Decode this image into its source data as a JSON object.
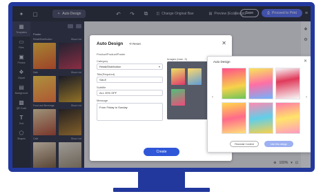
{
  "toolbar": {
    "auto_design_label": "Auto Design",
    "change_bg_label": "Change Original Bae",
    "preview_label": "Preview (Ecodesign)",
    "save_label": "Save",
    "proceed_label": "Proceed to Print"
  },
  "rail": {
    "items": [
      "Templates",
      "Files",
      "Photos",
      "Clipart",
      "Background",
      "QR Code",
      "Text",
      "Shapes"
    ]
  },
  "panel": {
    "heading": "Poster",
    "sections": [
      {
        "title": "Retail/Distribution",
        "action": "Show List"
      },
      {
        "title": "Sale",
        "action": "Show List"
      },
      {
        "title": "Food and Beverage",
        "action": "Show List"
      },
      {
        "title": "Cafe",
        "action": "Show List"
      }
    ]
  },
  "modal": {
    "title": "Auto Design",
    "reset_label": "Reset",
    "product_label": "Product/Product/Poster",
    "category_label": "Category",
    "category_value": "Retail/Distribution",
    "title_label": "Title(Required)",
    "title_value": "SALE",
    "subtitle_label": "Subtitle",
    "subtitle_value": "ALL 20% OFF",
    "message_label": "Message",
    "message_value": "From Friday to Sunday",
    "images_label": "Images (max. 3)",
    "create_label": "Create"
  },
  "results": {
    "title": "Auto Design",
    "regenerate_label": "Recreate Content",
    "use_label": "Use this design"
  },
  "zoom": {
    "value": "100%"
  },
  "colors": {
    "bezel": "#22389c",
    "accent": "#2f57d8",
    "toolbar": "#2b2e3d"
  }
}
